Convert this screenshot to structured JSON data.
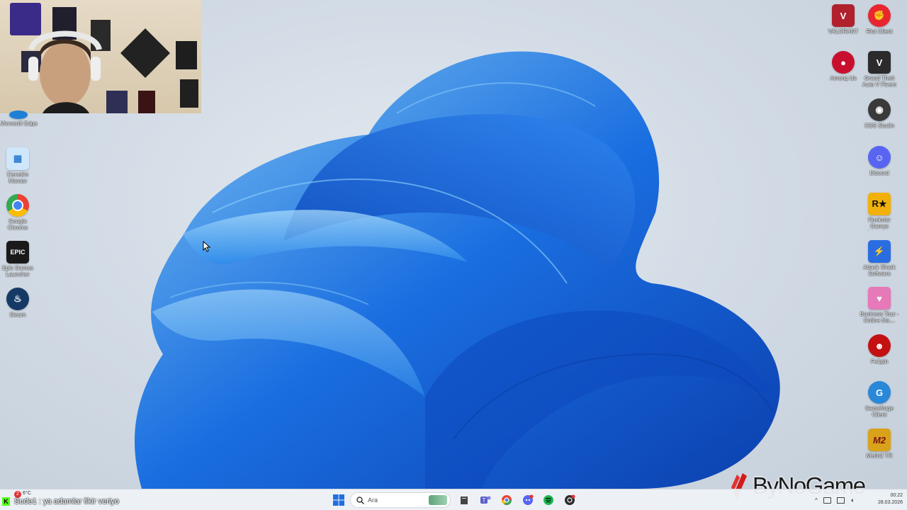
{
  "desktop_icons_left": [
    {
      "label": "Microsoft Edge",
      "color": "#1e7fd6",
      "glyph": "e"
    },
    {
      "label": "Denetim Masası",
      "color": "#3a8ed8",
      "glyph": "▦"
    },
    {
      "label": "Google Chrome",
      "color": "#ffffff",
      "glyph": ""
    },
    {
      "label": "Epic Games Launcher",
      "color": "#1a1a1a",
      "glyph": "EPIC"
    },
    {
      "label": "Steam",
      "color": "#163a66",
      "glyph": "♨"
    }
  ],
  "desktop_icons_right": [
    {
      "label": "VALORANT",
      "color": "#b0202d",
      "glyph": "V"
    },
    {
      "label": "Riot Client",
      "color": "#e8262f",
      "glyph": "✊"
    },
    {
      "label": "Among Us",
      "color": "#c8102e",
      "glyph": "●"
    },
    {
      "label": "Grand Theft Auto V Fivem",
      "color": "#2b2b2b",
      "glyph": "V"
    },
    {
      "label": "OBS Studio",
      "color": "#3a3a3a",
      "glyph": "◉"
    },
    {
      "label": "Discord",
      "color": "#5865f2",
      "glyph": "☺"
    },
    {
      "label": "Rockstar Games Launcher",
      "color": "#f2b10a",
      "glyph": "R★"
    },
    {
      "label": "Attack Shark Software",
      "color": "#f2d100",
      "glyph": "⚡"
    },
    {
      "label": "Business Tour - Online Mu…",
      "color": "#e679b8",
      "glyph": "♥"
    },
    {
      "label": "Fe1gin",
      "color": "#c41010",
      "glyph": "☻"
    },
    {
      "label": "Gameforge Client",
      "color": "#2a88d8",
      "glyph": "G"
    },
    {
      "label": "Metin2 TR",
      "color": "#d9a21a",
      "glyph": "M2"
    }
  ],
  "taskbar": {
    "status_text": "Sude1 : ya adamlar fikir veriyo",
    "notification_badge": "2",
    "temperature": "6°C",
    "search_placeholder": "Ara",
    "clock_time": "00:22",
    "clock_date": "28.03.2026"
  },
  "brand_overlay": "ByNoGame"
}
